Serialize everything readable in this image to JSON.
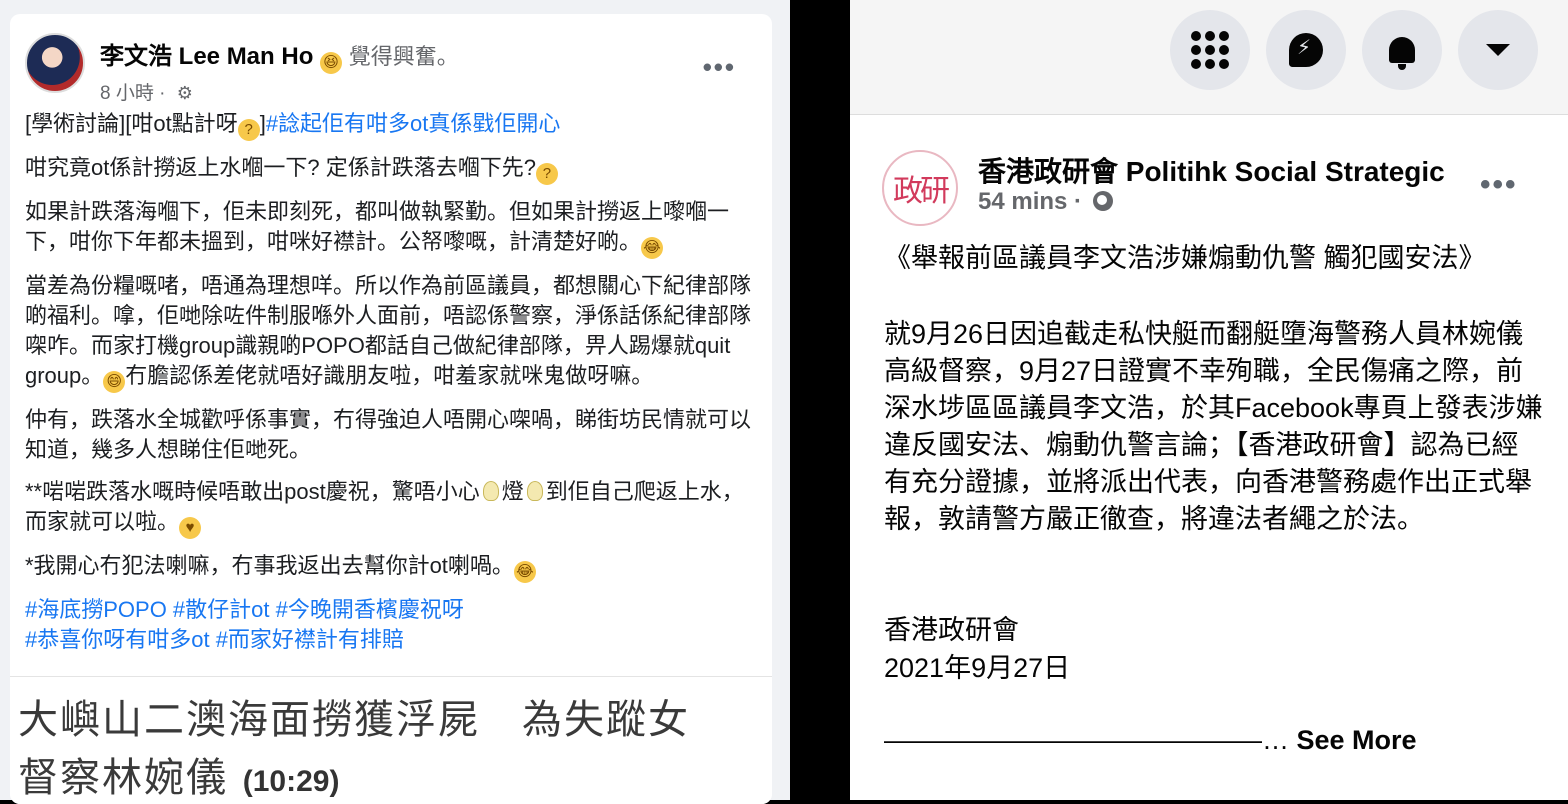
{
  "left_post": {
    "author": "李文浩 Lee Man Ho",
    "feeling": "覺得興奮。",
    "time": "8 小時 ·",
    "body": {
      "p1_prefix": "[學術討論][咁ot點計呀",
      "p1_suffix": "]",
      "p1_tag": "#諗起佢有咁多ot真係戥佢開心",
      "p2": "咁究竟ot係計撈返上水嗰一下? 定係計跌落去嗰下先?",
      "p3": "如果計跌落海嗰下，佢未即刻死，都叫做執緊勤。但如果計撈返上嚟嗰一下，咁你下年都未搵到，咁咪好襟計。公帑嚟嘅，計清楚好啲。",
      "p4": "當差為份糧嘅啫，唔通為理想咩。所以作為前區議員，都想關心下紀律部隊啲福利。嗱，佢哋除咗件制服喺外人面前，唔認係警察，淨係話係紀律部隊㗎咋。而家打機group識親啲POPO都話自己做紀律部隊，畀人踢爆就quit group。",
      "p4_after": "冇膽認係差佬就唔好識朋友啦，咁羞家就咪鬼做呀嘛。",
      "p5": "仲有，跌落水全城歡呼係事實，冇得強迫人唔開心㗎喎，睇街坊民情就可以知道，幾多人想睇住佢哋死。",
      "p6_a": "**啱啱跌落水嘅時候唔敢出post慶祝，驚唔小心",
      "p6_b": "燈",
      "p6_c": "到佢自己爬返上水，而家就可以啦。",
      "p7": "*我開心冇犯法喇嘛，冇事我返出去幫你計ot喇喎。",
      "tags_line1": "#海底撈POPO #散仔計ot #今晚開香檳慶祝呀",
      "tags_line2": "#恭喜你呀有咁多ot #而家好襟計有排賠"
    },
    "headline_line1": "大嶼山二澳海面撈獲浮屍　為失蹤女",
    "headline_line2": "督察林婉儀",
    "headline_time": "(10:29)"
  },
  "right_post": {
    "page_logo_text": "政研",
    "page_name": "香港政研會 Politihk Social Strategic",
    "time": "54 mins ·",
    "title": "《舉報前區議員李文浩涉嫌煽動仇警 觸犯國安法》",
    "paragraph": "就9月26日因追截走私快艇而翻艇墮海警務人員林婉儀高級督察，9月27日證實不幸殉職，全民傷痛之際，前深水埗區區議員李文浩，於其Facebook專頁上發表涉嫌違反國安法、煽動仇警言論；【香港政研會】認為已經有充分證據，並將派出代表，向香港警務處作出正式舉報，敦請警方嚴正徹查，將違法者繩之於法。",
    "signature": "香港政研會",
    "date": "2021年9月27日",
    "dashes": "——————————————…",
    "see_more": "See More"
  },
  "icons": {
    "menu": "grid-menu-icon",
    "messenger": "messenger-icon",
    "notifications": "bell-icon",
    "account": "caret-down-icon",
    "more": "more-options-icon",
    "privacy": "globe-icon",
    "settings": "gear-icon"
  },
  "colors": {
    "link": "#1877f2",
    "text": "#050505",
    "secondary": "#65676b"
  }
}
